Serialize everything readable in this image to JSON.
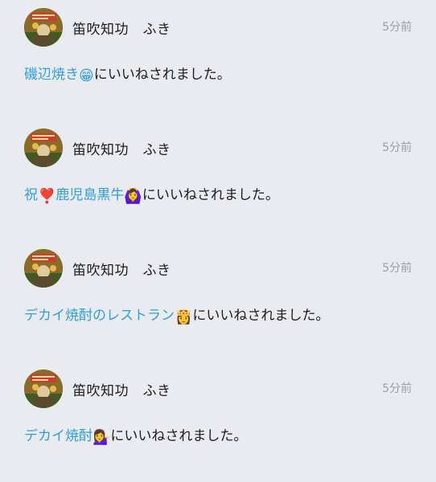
{
  "notifications": [
    {
      "user": "笛吹知功　ふき",
      "time": "5分前",
      "post_prefix": "",
      "post_prefix_icon": "",
      "post_title": "磯辺焼き",
      "post_emoji": "😁",
      "action": "にいいねされました。"
    },
    {
      "user": "笛吹知功　ふき",
      "time": "5分前",
      "post_prefix": "祝",
      "post_prefix_icon": "❣️",
      "post_title": "鹿児島黒牛",
      "post_emoji": "🙆‍♀️",
      "action": "にいいねされました。"
    },
    {
      "user": "笛吹知功　ふき",
      "time": "5分前",
      "post_prefix": "",
      "post_prefix_icon": "",
      "post_title": "デカイ焼酎のレストラン",
      "post_emoji": "👸",
      "action": "にいいねされました。"
    },
    {
      "user": "笛吹知功　ふき",
      "time": "5分前",
      "post_prefix": "",
      "post_prefix_icon": "",
      "post_title": "デカイ焼酎",
      "post_emoji": "💁‍♀️",
      "action": "にいいねされました。"
    }
  ]
}
